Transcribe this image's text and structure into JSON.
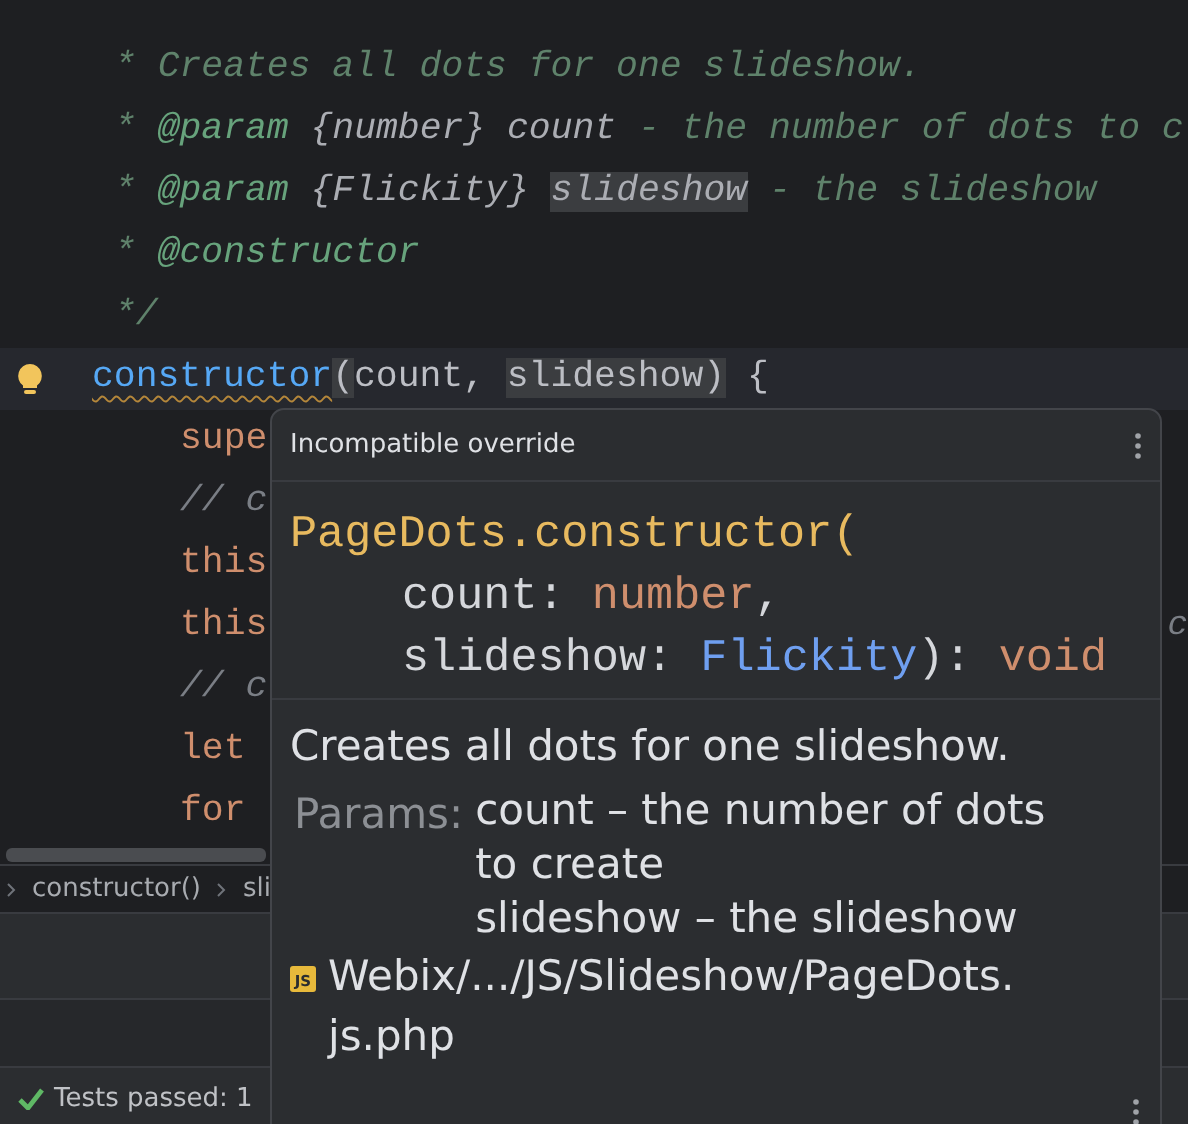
{
  "editor": {
    "lines": [
      {
        "kind": "doc",
        "tokens": [
          {
            "kind": "comment",
            "text": "* Creates all dots for one slideshow."
          }
        ]
      },
      {
        "kind": "doc",
        "tokens": [
          {
            "kind": "comment",
            "text": "* "
          },
          {
            "kind": "tag",
            "text": "@param"
          },
          {
            "kind": "doc-ref",
            "text": " {number} count"
          },
          {
            "kind": "comment",
            "text": " - the number of dots to c"
          }
        ]
      },
      {
        "kind": "doc",
        "tokens": [
          {
            "kind": "comment",
            "text": "* "
          },
          {
            "kind": "tag",
            "text": "@param"
          },
          {
            "kind": "doc-ref",
            "text": " {Flickity} "
          },
          {
            "kind": "doc-ref",
            "text": "slideshow",
            "highlight": true
          },
          {
            "kind": "comment",
            "text": " - the slideshow"
          }
        ]
      },
      {
        "kind": "doc",
        "tokens": [
          {
            "kind": "comment",
            "text": "* "
          },
          {
            "kind": "tag",
            "text": "@constructor"
          }
        ]
      },
      {
        "kind": "doc",
        "tokens": [
          {
            "kind": "comment",
            "text": "*/"
          }
        ]
      },
      {
        "kind": "signature",
        "current": true,
        "bulb": true,
        "tokens": [
          {
            "kind": "warning",
            "text": "constructor"
          },
          {
            "kind": "plain",
            "text": "(",
            "highlight": true
          },
          {
            "kind": "plain",
            "text": "count, "
          },
          {
            "kind": "plain",
            "text": "slideshow)",
            "highlight": true
          },
          {
            "kind": "plain",
            "text": " {"
          }
        ]
      },
      {
        "kind": "body",
        "tokens": [
          {
            "kind": "keyword",
            "text": "supe"
          }
        ]
      },
      {
        "kind": "body",
        "tokens": [
          {
            "kind": "line-comment",
            "text": "// c"
          }
        ]
      },
      {
        "kind": "body",
        "tokens": [
          {
            "kind": "keyword",
            "text": "this"
          }
        ]
      },
      {
        "kind": "body",
        "tokens": [
          {
            "kind": "keyword",
            "text": "this"
          }
        ],
        "tail": "c"
      },
      {
        "kind": "body",
        "tokens": [
          {
            "kind": "line-comment",
            "text": "// c"
          }
        ]
      },
      {
        "kind": "body",
        "tokens": [
          {
            "kind": "keyword",
            "text": "let"
          }
        ]
      },
      {
        "kind": "body",
        "tokens": [
          {
            "kind": "keyword",
            "text": "for"
          }
        ]
      }
    ]
  },
  "breadcrumbs": [
    "constructor()",
    "sli"
  ],
  "status_bar": {
    "tests": "Tests passed: 1"
  },
  "popup": {
    "title": "Incompatible override",
    "signature": [
      [
        {
          "kind": "fn",
          "text": "PageDots.constructor("
        }
      ],
      [
        {
          "kind": "param",
          "text": "count: "
        },
        {
          "kind": "keyword",
          "text": "number"
        },
        {
          "kind": "param",
          "text": ","
        }
      ],
      [
        {
          "kind": "param",
          "text": "slideshow: "
        },
        {
          "kind": "type",
          "text": "Flickity"
        },
        {
          "kind": "param",
          "text": "): "
        },
        {
          "kind": "keyword",
          "text": "void"
        }
      ]
    ],
    "description": "Creates all dots for one slideshow.",
    "params_label": "Params:",
    "params": [
      "count – the number of dots to create",
      "slideshow – the slideshow"
    ],
    "file": {
      "icon": "JS",
      "path": "Webix/.../JS/Slideshow/PageDots.js.php"
    }
  }
}
